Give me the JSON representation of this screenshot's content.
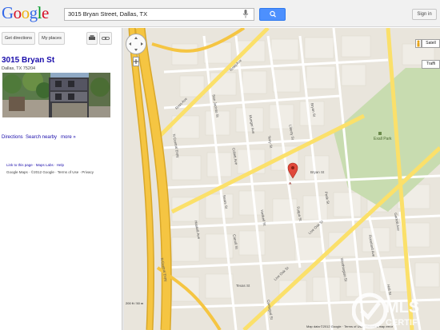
{
  "search": {
    "query": "3015 Bryan Street, Dallas, TX"
  },
  "header": {
    "signin_label": "Sign in"
  },
  "panel": {
    "get_directions_label": "Get directions",
    "my_places_label": "My places",
    "place_name": "3015 Bryan St",
    "place_address": "Dallas, TX 75204",
    "directions_link": "Directions",
    "search_nearby_link": "Search nearby",
    "more_link": "more »",
    "footer_links": "Link to this page · Maps Labs · Help",
    "footer_copyright": "Google Maps · ©2012 Google · Terms of Use · Privacy"
  },
  "map": {
    "satellite_label": "Satell",
    "traffic_label": "Traffi",
    "park_label": "Exall Park",
    "scale_label": "200 ft / 50 m",
    "copyright": "Map data ©2012 Google · Terms of Use · Report a map error",
    "streets": {
      "bryan": "Bryan St",
      "live_oak": "Live Oak St",
      "ross": "Ross Ave",
      "gaston": "San Jacinto St",
      "central": "N Central Expy",
      "hall": "Texas St",
      "carroll": "Carroll St",
      "cantegral": "Cantegral St",
      "peak": "Peak St",
      "haskell": "Haskell St",
      "munger": "Munger Ave",
      "terry": "Terry St",
      "elm": "Liberty St",
      "roseland": "Roseland Ave",
      "worthington": "Worthington St",
      "garrett": "Garrett Ave",
      "fuqua": "Fuqua St",
      "sears": "Sears St",
      "summit": "Hall St",
      "collett": "Collett Ave",
      "brandon": "Bryan St",
      "ham": "Haskell Ave"
    },
    "marker_label": "A"
  },
  "colors": {
    "highway": "#f5c542",
    "highway_edge": "#d9a82a",
    "arterial": "#fbe06a",
    "park": "#c8dcb0",
    "land": "#e9e5dc",
    "marker": "#e0483a"
  },
  "watermark": {
    "text": "MLS CERTIFIED"
  }
}
